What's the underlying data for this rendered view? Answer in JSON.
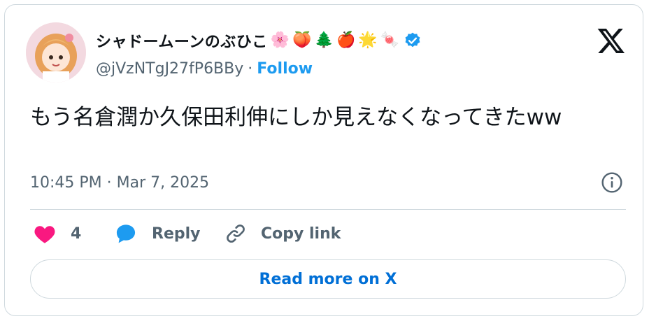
{
  "author": {
    "display_name": "シャドームーンのぶひこ",
    "emojis": [
      "🌸",
      "🍑",
      "🌲",
      "🍎",
      "🌟",
      "🍬"
    ],
    "handle": "@jVzNTgJ27fP6BBy",
    "separator": "·",
    "follow_label": "Follow",
    "avatar_icon": "anime-girl-avatar"
  },
  "tweet": {
    "text": "もう名倉潤か久保田利伸にしか見えなくなってきたww",
    "timestamp": "10:45 PM · Mar 7, 2025"
  },
  "actions": {
    "like_count": "4",
    "reply_label": "Reply",
    "copy_label": "Copy link"
  },
  "read_more_label": "Read more on X",
  "colors": {
    "accent": "#1d9bf0",
    "link": "#006fd6",
    "like": "#f91880",
    "muted": "#536471",
    "border": "#cfd9de"
  }
}
